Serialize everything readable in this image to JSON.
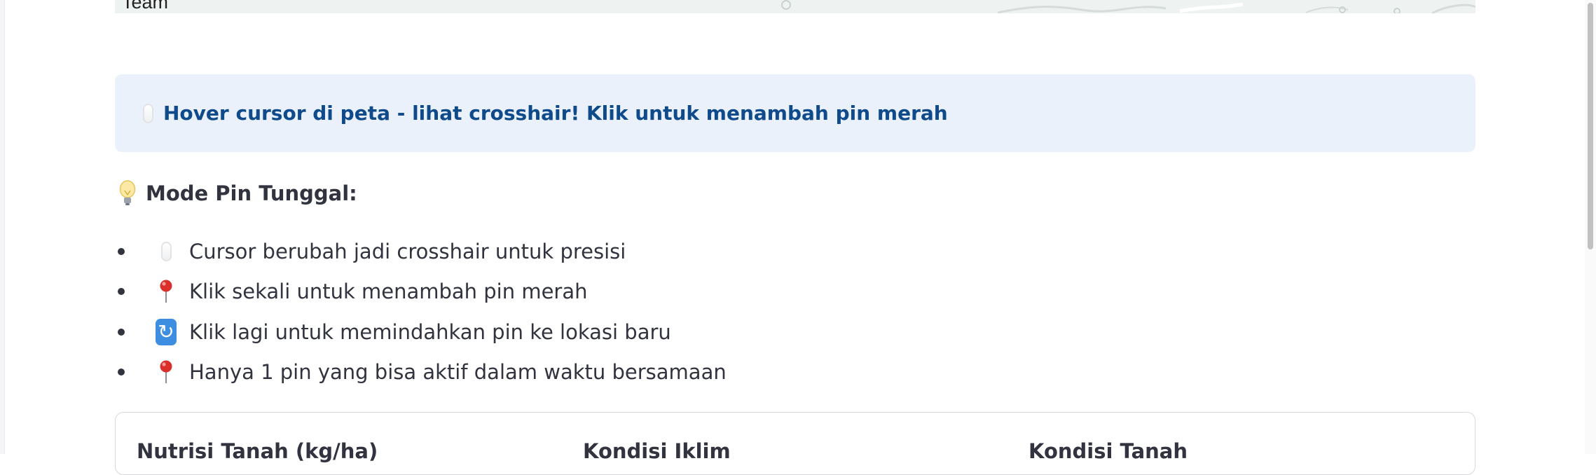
{
  "map": {
    "partial_label": "Team"
  },
  "info": {
    "icon": "computer-mouse-icon",
    "text": "Hover cursor di peta - lihat crosshair! Klik untuk menambah pin merah",
    "background_color": "#eaf1fb",
    "text_color": "#0f4a8a"
  },
  "mode": {
    "icon": "light-bulb-icon",
    "title": "Mode Pin Tunggal:"
  },
  "tips": [
    {
      "icon": "computer-mouse-icon",
      "text": "Cursor berubah jadi crosshair untuk presisi"
    },
    {
      "icon": "red-pushpin-icon",
      "text": "Klik sekali untuk menambah pin merah"
    },
    {
      "icon": "cycle-arrows-icon",
      "text": "Klik lagi untuk memindahkan pin ke lokasi baru"
    },
    {
      "icon": "red-pushpin-icon",
      "text": "Hanya 1 pin yang bisa aktif dalam waktu bersamaan"
    }
  ],
  "card": {
    "columns": [
      {
        "title": "Nutrisi Tanah (kg/ha)"
      },
      {
        "title": "Kondisi Iklim"
      },
      {
        "title": "Kondisi Tanah"
      }
    ]
  }
}
